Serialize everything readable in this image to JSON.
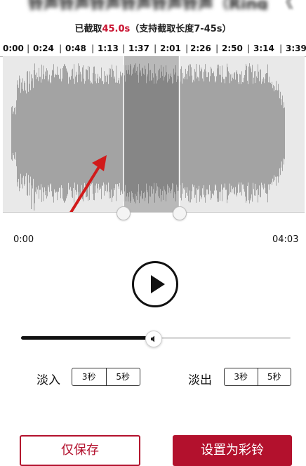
{
  "header": {
    "title_blurred": "铃声铃声铃声铃声铃声铃声（Ringtone）",
    "title_right_partial": "《"
  },
  "clip_info": {
    "prefix": "已截取",
    "duration": "45.0s",
    "suffix": "（支持截取长度7-45s）",
    "duration_color": "#c8102e"
  },
  "timeline": {
    "ticks": [
      "0:00",
      "0:24",
      "0:48",
      "1:13",
      "1:37",
      "2:01",
      "2:26",
      "2:50",
      "3:14",
      "3:39"
    ]
  },
  "selection": {
    "start_fraction": 0.4,
    "end_fraction": 0.585
  },
  "range": {
    "start": "0:00",
    "end": "04:03"
  },
  "player": {
    "play_icon": "play-icon",
    "progress_fraction": 0.49
  },
  "fade": {
    "in_label": "淡入",
    "out_label": "淡出",
    "in_options": [
      "3秒",
      "5秒"
    ],
    "out_options": [
      "3秒",
      "5秒"
    ]
  },
  "actions": {
    "save_label": "仅保存",
    "set_ringtone_label": "设置为彩铃"
  },
  "colors": {
    "accent": "#b3112d"
  }
}
